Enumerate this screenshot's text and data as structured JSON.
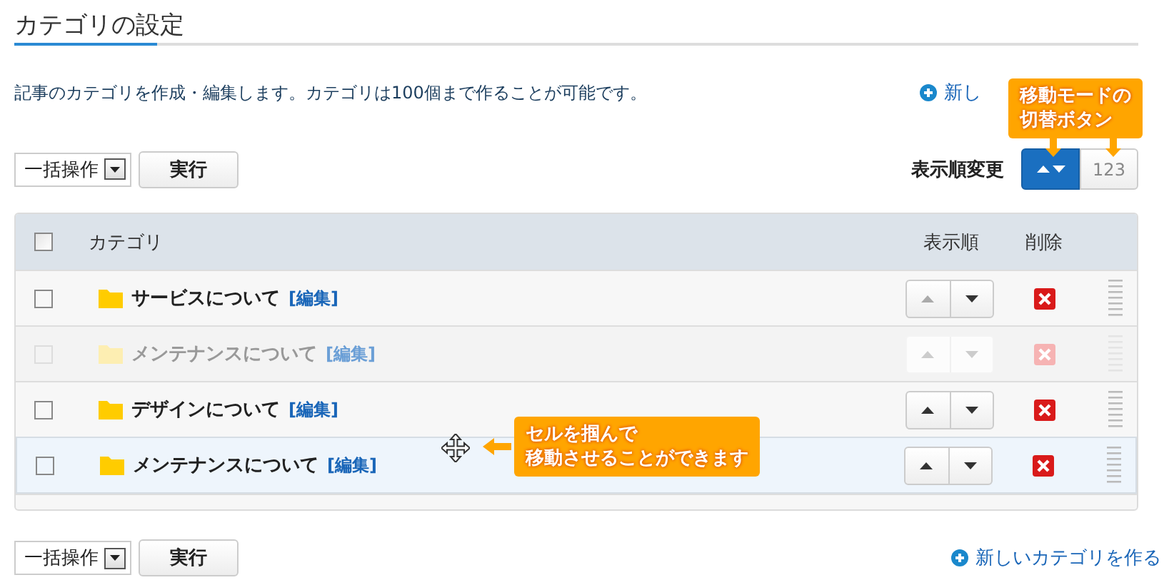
{
  "page": {
    "title": "カテゴリの設定",
    "description": "記事のカテゴリを作成・編集します。カテゴリは100個まで作ることが可能です。",
    "top_link": "新し"
  },
  "bulk_top": {
    "select": "一括操作",
    "button": "実行"
  },
  "order_mode": {
    "label": "表示順変更",
    "buttons": [
      {
        "kind": "arrows",
        "selected": true
      },
      {
        "kind": "text",
        "label": "123",
        "selected": false
      }
    ]
  },
  "table": {
    "columns": [
      "カテゴリ",
      "表示順",
      "削除"
    ],
    "header_checked": false,
    "rows": [
      {
        "kind": "normal",
        "name": "サービスについて",
        "edit": "[編集]",
        "checked": false,
        "can_move_up": false
      },
      {
        "kind": "placeholder",
        "name": "メンテナンスについて",
        "edit": "[編集]",
        "checked": false,
        "can_move_up": true
      },
      {
        "kind": "normal",
        "name": "デザインについて",
        "edit": "[編集]",
        "checked": false,
        "can_move_up": true
      },
      {
        "kind": "dragging",
        "name": "メンテナンスについて",
        "edit": "[編集]",
        "checked": false,
        "can_move_up": true
      }
    ]
  },
  "bulk_bottom": {
    "select": "一括操作",
    "button": "実行"
  },
  "bottom_link": "新しいカテゴリを作る",
  "callouts": [
    {
      "kind": "down",
      "lines": [
        "移動モードの",
        "切替ボタン"
      ]
    },
    {
      "kind": "left",
      "lines": [
        "セルを掴んで",
        "移動させることができます"
      ]
    }
  ]
}
